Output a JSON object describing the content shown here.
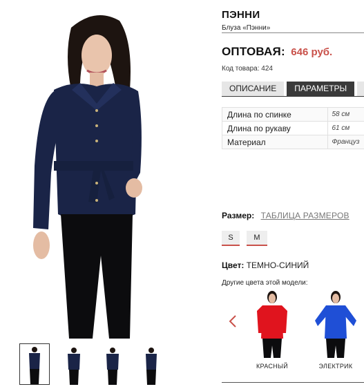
{
  "product": {
    "title": "ПЭННИ",
    "subtitle": "Блуза «Пэнни»",
    "price_label": "ОПТОВАЯ:",
    "price_value": "646 руб.",
    "code": "Код товара: 424"
  },
  "tabs": [
    {
      "label": "ОПИСАНИЕ"
    },
    {
      "label": "ПАРАМЕТРЫ"
    }
  ],
  "params": [
    {
      "name": "Длина по спинке",
      "value": "58 см"
    },
    {
      "name": "Длина по рукаву",
      "value": "61 см"
    },
    {
      "name": "Материал",
      "value": "Француз"
    }
  ],
  "size": {
    "label": "Размер:",
    "table_link": "ТАБЛИЦА РАЗМЕРОВ",
    "options": [
      "S",
      "M"
    ]
  },
  "color": {
    "label": "Цвет:",
    "value": "ТЕМНО-СИНИЙ",
    "other_label": "Другие цвета этой модели:"
  },
  "variants": [
    {
      "label": "КРАСНЫЙ",
      "color": "#e0141e"
    },
    {
      "label": "ЭЛЕКТРИК",
      "color": "#1f4fd6"
    }
  ],
  "colors": {
    "accent": "#c9514a",
    "navy": "#1a2447",
    "tab_active": "#3a3a3a"
  },
  "icons": [
    "chevron-left-icon"
  ]
}
